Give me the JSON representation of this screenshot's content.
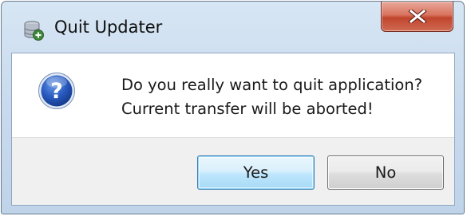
{
  "window": {
    "title": "Quit Updater",
    "title_icon": "updater-app-icon",
    "close_icon": "close-icon"
  },
  "dialog": {
    "icon": "question-icon",
    "message_line1": "Do you really want to quit application?",
    "message_line2": "Current transfer will be aborted!"
  },
  "buttons": {
    "yes_label": "Yes",
    "no_label": "No",
    "default": "yes"
  },
  "colors": {
    "close_button_red": "#c1452d",
    "default_button_border": "#3c7fb1",
    "question_icon_blue": "#1f4fa8"
  }
}
